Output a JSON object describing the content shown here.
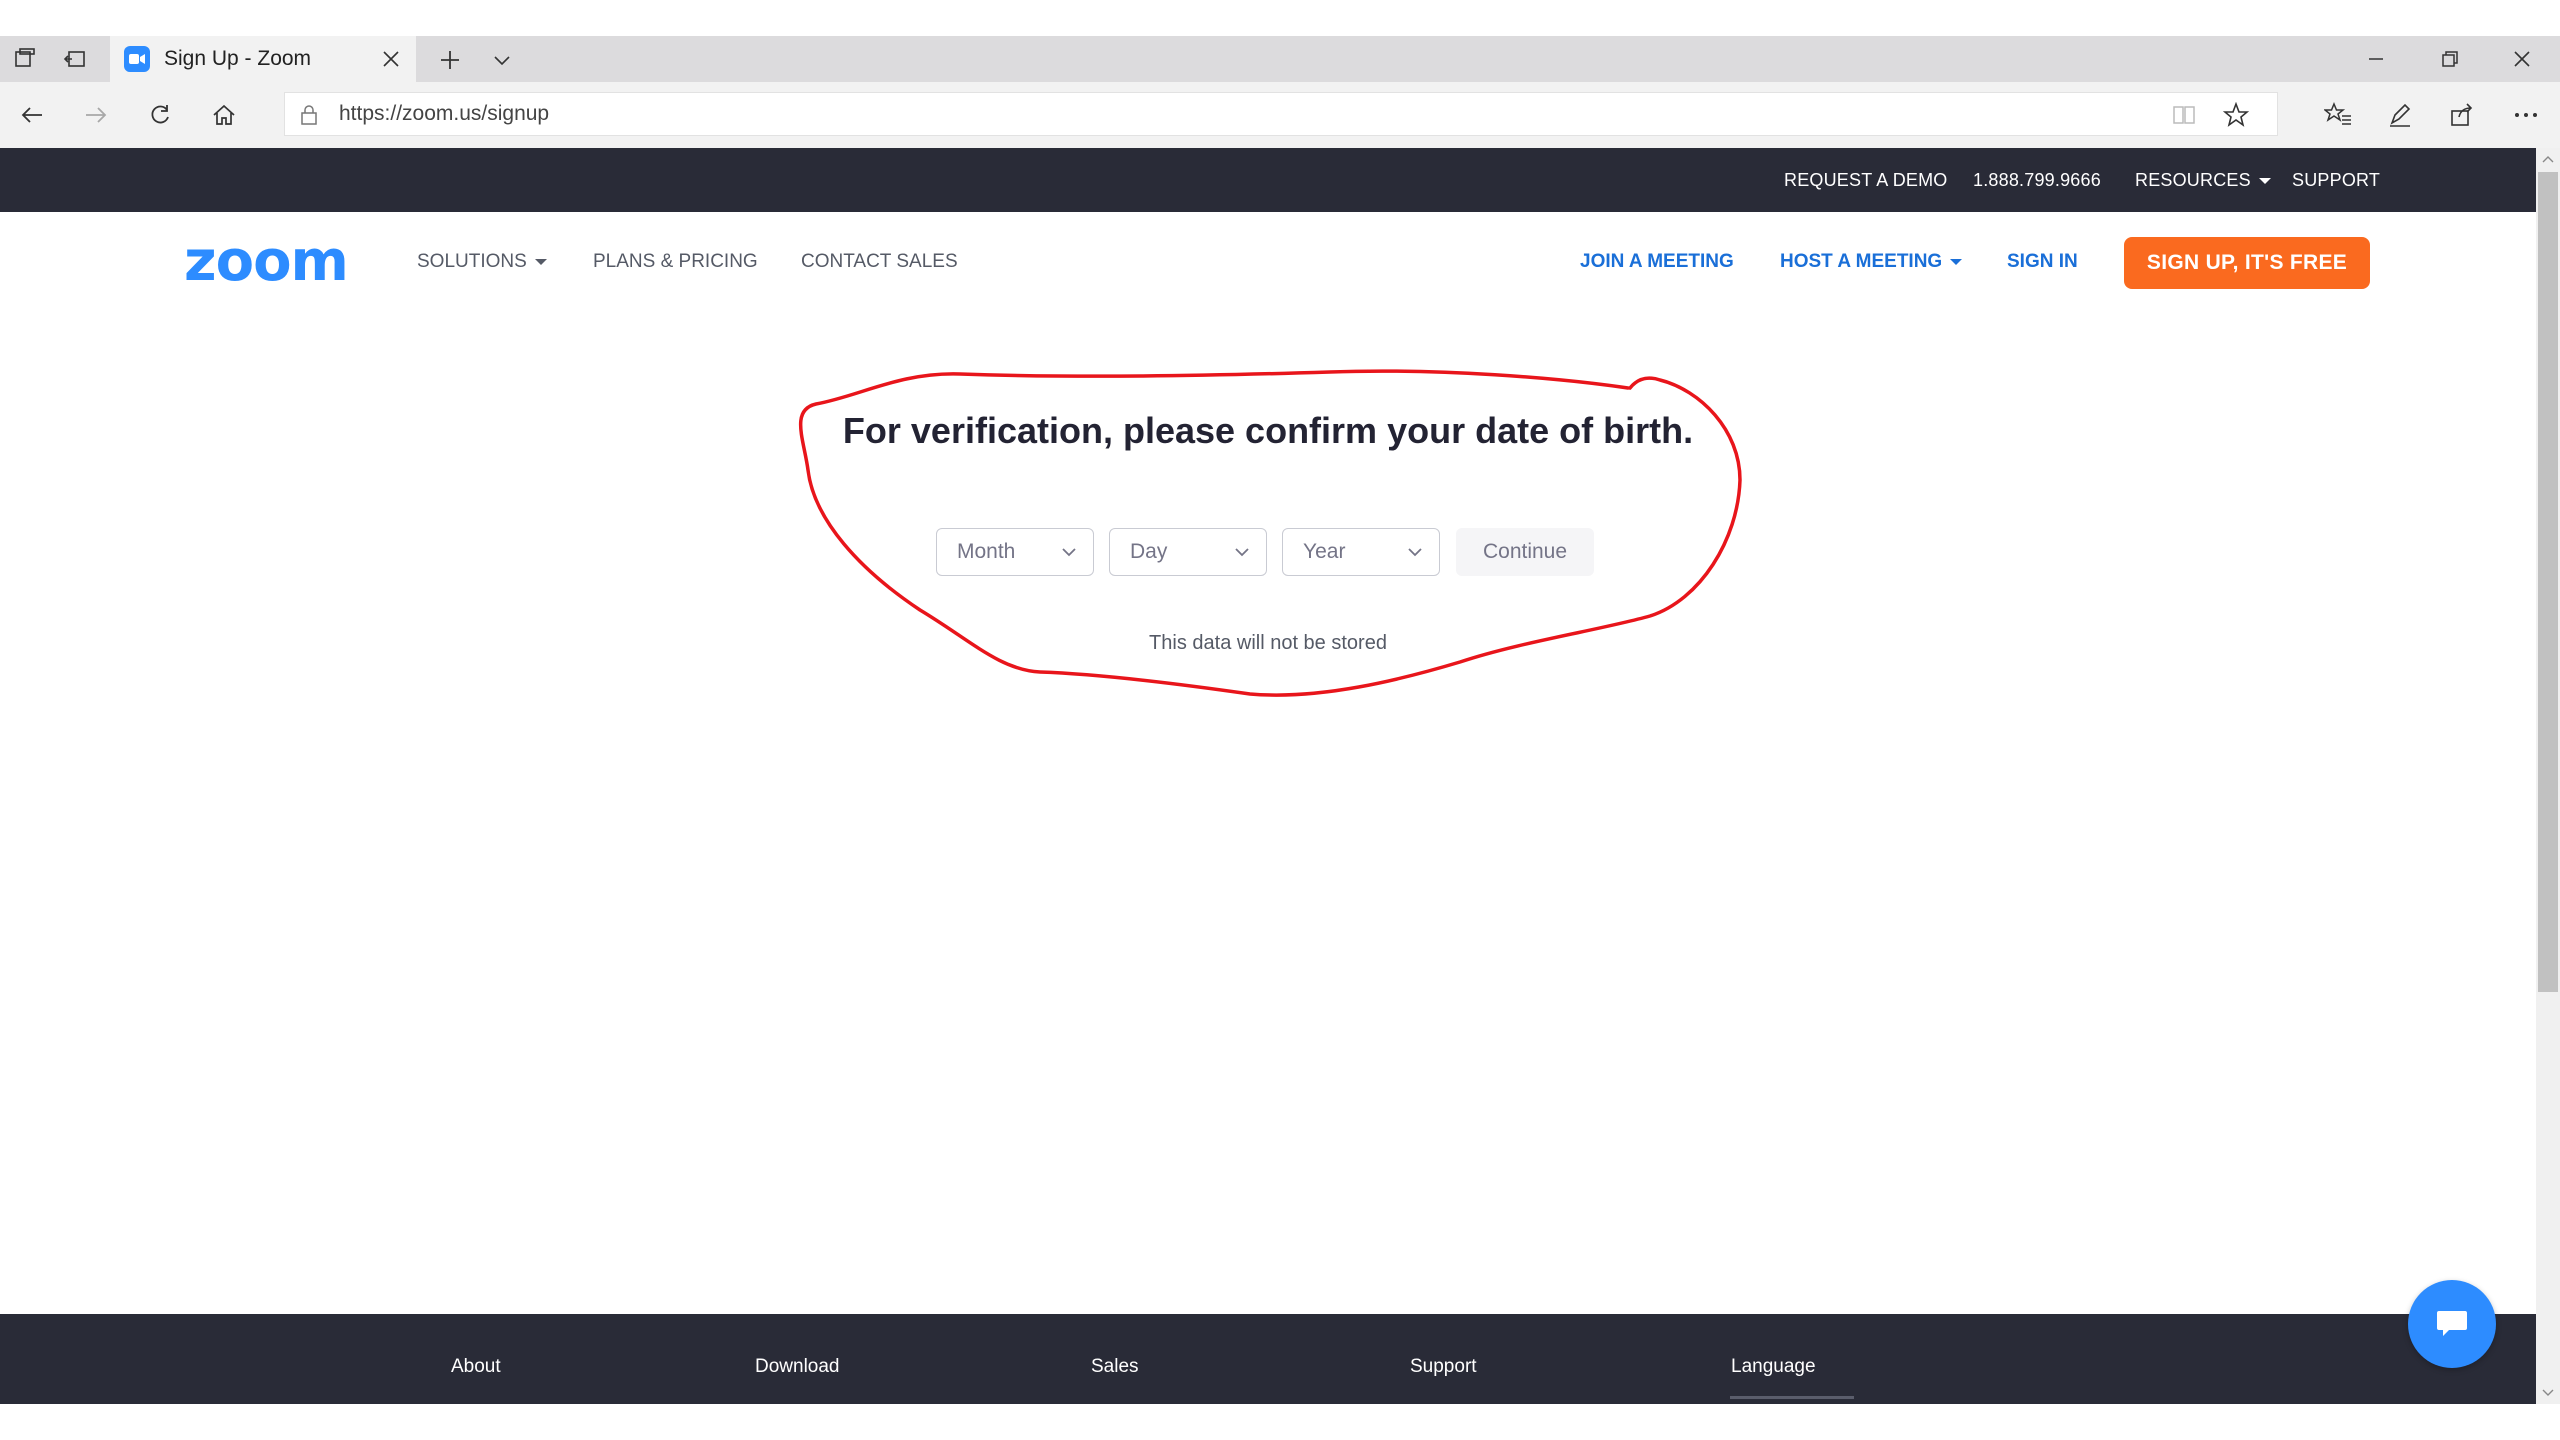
{
  "browser": {
    "tab_title": "Sign Up - Zoom",
    "url": "https://zoom.us/signup"
  },
  "utility_bar": {
    "request_demo": "REQUEST A DEMO",
    "phone": "1.888.799.9666",
    "resources": "RESOURCES",
    "support": "SUPPORT"
  },
  "nav": {
    "logo": "zoom",
    "solutions": "SOLUTIONS",
    "plans_pricing": "PLANS & PRICING",
    "contact_sales": "CONTACT SALES",
    "join_meeting": "JOIN A MEETING",
    "host_meeting": "HOST A MEETING",
    "sign_in": "SIGN IN",
    "signup_button": "SIGN UP, IT'S FREE"
  },
  "verification": {
    "headline": "For verification, please confirm your date of birth.",
    "month_placeholder": "Month",
    "day_placeholder": "Day",
    "year_placeholder": "Year",
    "continue_label": "Continue",
    "note": "This data will not be stored"
  },
  "footer": {
    "about": "About",
    "download": "Download",
    "sales": "Sales",
    "support": "Support",
    "language": "Language"
  },
  "colors": {
    "brand_blue": "#2d8cff",
    "signup_orange": "#fa6a1f",
    "dark_bar": "#292b37",
    "annotation_red": "#e8151b"
  },
  "icons": [
    "tab-set-aside-icon",
    "tab-preview-icon",
    "zoom-favicon-icon",
    "close-icon",
    "new-tab-icon",
    "chevron-down-icon",
    "minimize-icon",
    "restore-icon",
    "window-close-icon",
    "back-icon",
    "forward-icon",
    "refresh-icon",
    "home-icon",
    "lock-icon",
    "reading-view-icon",
    "favorite-star-icon",
    "favorites-hub-icon",
    "pen-icon",
    "share-icon",
    "more-icon",
    "chat-icon"
  ]
}
